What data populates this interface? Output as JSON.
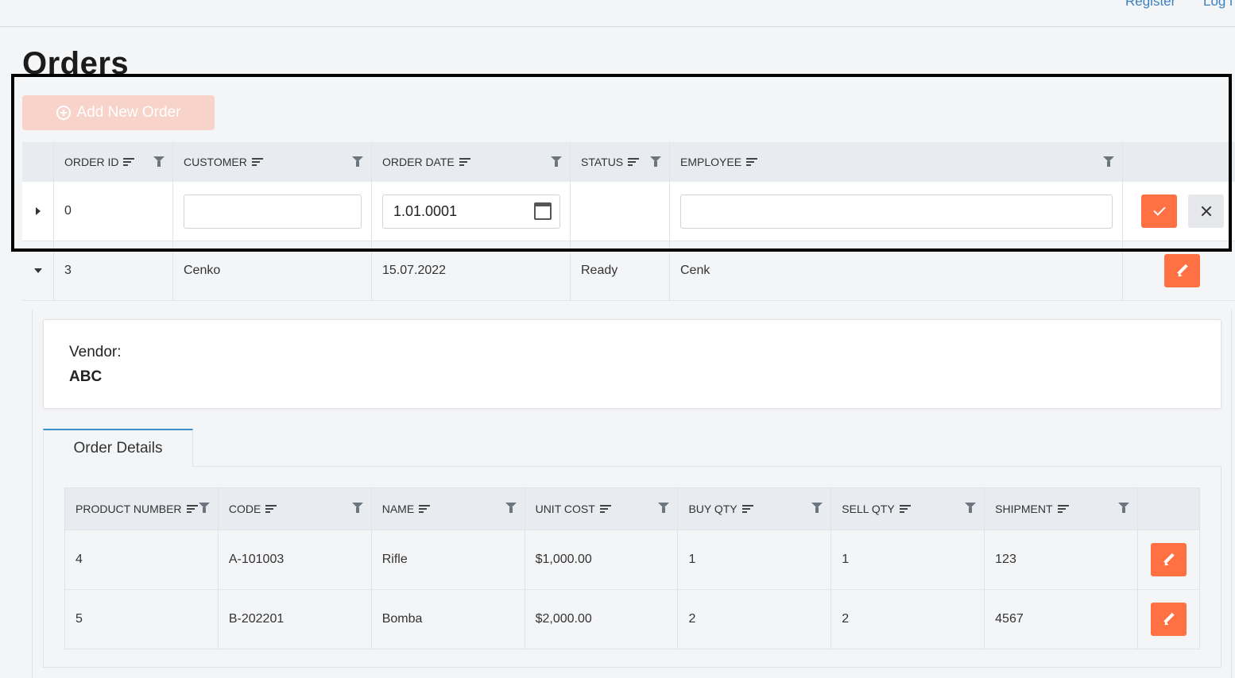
{
  "topnav": {
    "register": "Register",
    "login": "Log i"
  },
  "page": {
    "title": "Orders"
  },
  "toolbar": {
    "add_label": "Add New Order"
  },
  "grid": {
    "columns": [
      "ORDER ID",
      "CUSTOMER",
      "ORDER DATE",
      "STATUS",
      "EMPLOYEE"
    ],
    "edit_row": {
      "order_id": "0",
      "customer": "",
      "order_date": "1.01.0001",
      "status": "",
      "employee": ""
    },
    "rows": [
      {
        "order_id": "3",
        "customer": "Cenko",
        "order_date": "15.07.2022",
        "status": "Ready",
        "employee": "Cenk"
      }
    ]
  },
  "detail": {
    "vendor_label": "Vendor:",
    "vendor_value": "ABC",
    "tab_label": "Order Details",
    "columns": [
      "PRODUCT NUMBER",
      "CODE",
      "NAME",
      "UNIT COST",
      "BUY QTY",
      "SELL QTY",
      "SHIPMENT"
    ],
    "rows": [
      {
        "product_number": "4",
        "code": "A-101003",
        "name": "Rifle",
        "unit_cost": "$1,000.00",
        "buy_qty": "1",
        "sell_qty": "1",
        "shipment": "123"
      },
      {
        "product_number": "5",
        "code": "B-202201",
        "name": "Bomba",
        "unit_cost": "$2,000.00",
        "buy_qty": "2",
        "sell_qty": "2",
        "shipment": "4567"
      }
    ]
  },
  "colors": {
    "accent": "#ff7043",
    "accent_disabled": "#f8d3c9",
    "link": "#3a7fc1",
    "tab_border": "#3a8dc9"
  }
}
